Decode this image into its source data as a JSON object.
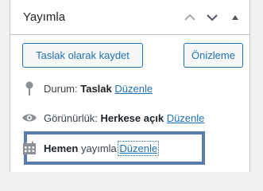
{
  "panel": {
    "title": "Yayımla",
    "controls": {
      "up_icon": "chevron-up-icon",
      "down_icon": "chevron-down-icon",
      "toggle_icon": "triangle-up-icon"
    }
  },
  "actions": {
    "save_draft_label": "Taslak olarak kaydet",
    "preview_label": "Önizleme"
  },
  "status": {
    "label": "Durum:",
    "value": "Taslak",
    "edit_label": "Düzenle",
    "icon": "pin-icon"
  },
  "visibility": {
    "label": "Görünürlük:",
    "value": "Herkese açık",
    "edit_label": "Düzenle",
    "icon": "eye-icon"
  },
  "schedule": {
    "value": "Hemen",
    "label": "yayımla",
    "edit_label": "Düzenle",
    "icon": "calendar-icon"
  },
  "colors": {
    "accent": "#2271b1",
    "highlight_border": "#5b7dab"
  }
}
